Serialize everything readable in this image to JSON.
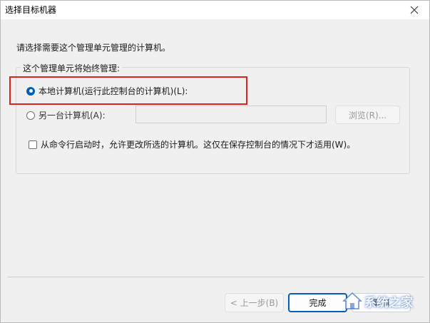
{
  "window": {
    "title": "选择目标机器"
  },
  "prompt": "请选择需要这个管理单元管理的计算机。",
  "group": {
    "legend": "这个管理单元将始终管理:",
    "local_option": {
      "label": "本地计算机(运行此控制台的计算机)(L):",
      "checked": true
    },
    "other_option": {
      "label": "另一台计算机(A):",
      "checked": false
    },
    "computer_name": {
      "value": "",
      "placeholder": ""
    },
    "browse_label": "浏览(R)...",
    "allow_change_label": "从命令行启动时，允许更改所选的计算机。这仅在保存控制台的情况下才适用(W)。"
  },
  "footer": {
    "back_label": "< 上一步(B)",
    "finish_label": "完成",
    "cancel_label": "取消"
  },
  "watermark": {
    "text": "系统之家"
  },
  "colors": {
    "accent": "#005fb8",
    "highlight": "#e0201e"
  },
  "icons": {
    "close": "close-icon",
    "watermark_logo": "house-logo-icon"
  }
}
